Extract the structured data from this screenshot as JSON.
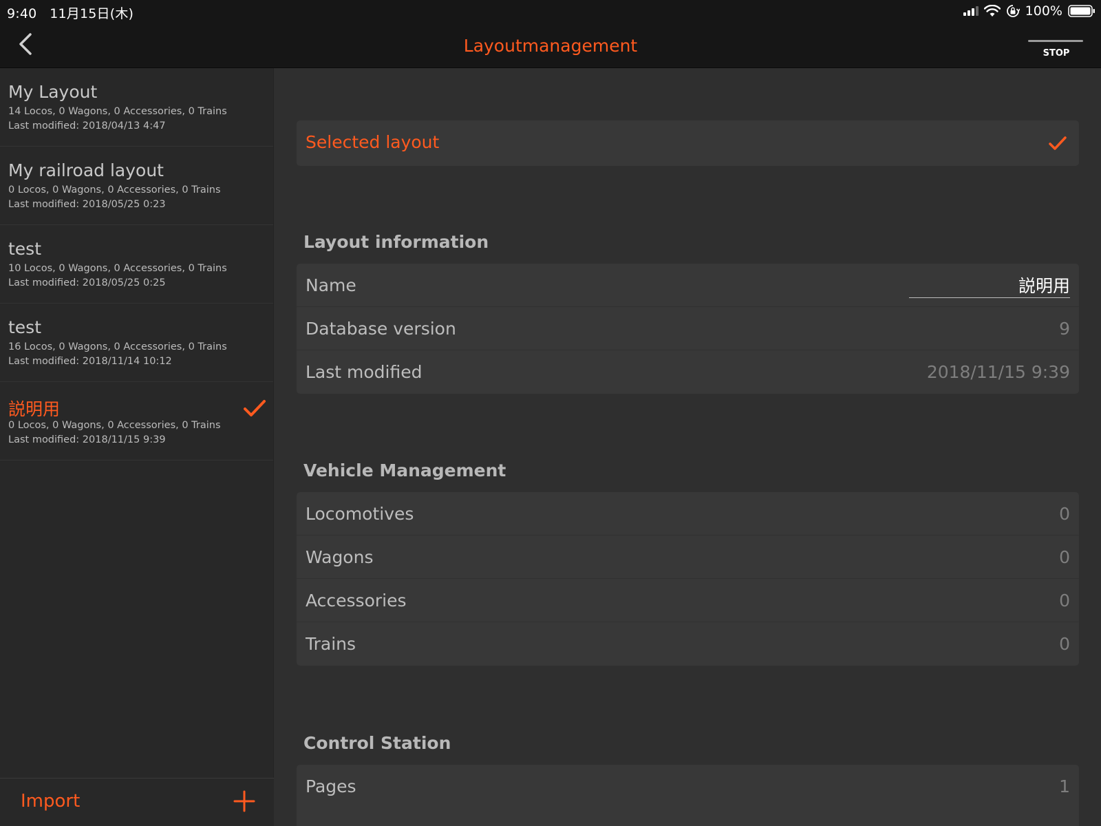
{
  "status_bar": {
    "time": "9:40",
    "date": "11月15日(木)",
    "battery": "100%"
  },
  "nav": {
    "title": "Layoutmanagement",
    "stop_label": "STOP"
  },
  "colors": {
    "accent": "#ff5a1f",
    "background": "#2f2f2f",
    "sidebar": "#282828",
    "card": "#383838"
  },
  "sidebar": {
    "items": [
      {
        "title": "My Layout",
        "counts": "14 Locos, 0 Wagons, 0 Accessories, 0 Trains",
        "modified": "Last modified: 2018/04/13 4:47"
      },
      {
        "title": "My railroad layout",
        "counts": "0 Locos, 0 Wagons, 0 Accessories, 0 Trains",
        "modified": "Last modified: 2018/05/25 0:23"
      },
      {
        "title": "test",
        "counts": "10 Locos, 0 Wagons, 0 Accessories, 0 Trains",
        "modified": "Last modified: 2018/05/25 0:25"
      },
      {
        "title": "test",
        "counts": "16 Locos, 0 Wagons, 0 Accessories, 0 Trains",
        "modified": "Last modified: 2018/11/14 10:12"
      },
      {
        "title": "説明用",
        "counts": "0 Locos, 0 Wagons, 0 Accessories, 0 Trains",
        "modified": "Last modified: 2018/11/15 9:39",
        "selected": true
      }
    ],
    "import_label": "Import"
  },
  "main": {
    "selected_label": "Selected layout",
    "layout_info": {
      "heading": "Layout information",
      "name_label": "Name",
      "name_value": "説明用",
      "db_label": "Database version",
      "db_value": "9",
      "modified_label": "Last modified",
      "modified_value": "2018/11/15 9:39"
    },
    "vehicles": {
      "heading": "Vehicle Management",
      "rows": [
        {
          "label": "Locomotives",
          "value": "0"
        },
        {
          "label": "Wagons",
          "value": "0"
        },
        {
          "label": "Accessories",
          "value": "0"
        },
        {
          "label": "Trains",
          "value": "0"
        }
      ]
    },
    "control_station": {
      "heading": "Control Station",
      "rows": [
        {
          "label": "Pages",
          "value": "1"
        }
      ]
    }
  }
}
